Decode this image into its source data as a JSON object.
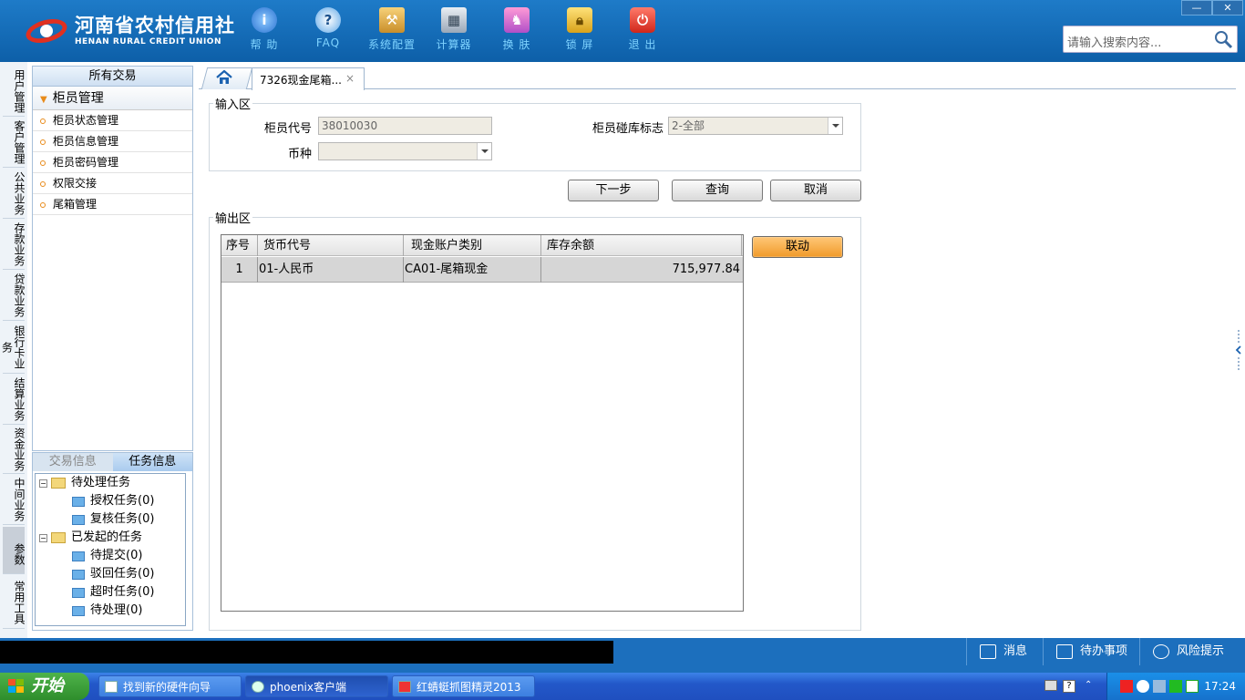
{
  "brand": {
    "name_cn": "河南省农村信用社",
    "name_en": "HENAN RURAL CREDIT UNION"
  },
  "toolbar": [
    {
      "label": "帮 助",
      "icon": "info-icon"
    },
    {
      "label": "FAQ",
      "icon": "question-icon"
    },
    {
      "label": "系统配置",
      "icon": "toolbox-icon"
    },
    {
      "label": "计算器",
      "icon": "calculator-icon"
    },
    {
      "label": "换 肤",
      "icon": "shirt-icon"
    },
    {
      "label": "锁 屏",
      "icon": "lock-icon"
    },
    {
      "label": "退 出",
      "icon": "power-icon"
    }
  ],
  "search": {
    "placeholder": "请输入搜索内容..."
  },
  "vtabs": [
    "用户管理",
    "客户管理",
    "公共业务",
    "存款业务",
    "贷款业务",
    "银行卡业务",
    "结算业务",
    "资金业务",
    "中间业务",
    "参数",
    "常用工具"
  ],
  "menu": {
    "header": "所有交易",
    "group": "柜员管理",
    "items": [
      "柜员状态管理",
      "柜员信息管理",
      "柜员密码管理",
      "权限交接",
      "尾箱管理"
    ]
  },
  "tasks": {
    "tab_trade": "交易信息",
    "tab_task": "任务信息",
    "tree": [
      "待处理任务",
      "授权任务(0)",
      "复核任务(0)",
      "已发起的任务",
      "待提交(0)",
      "驳回任务(0)",
      "超时任务(0)",
      "待处理(0)"
    ]
  },
  "tabs": {
    "current": "7326现金尾箱...",
    "close": "×"
  },
  "input_area": {
    "legend": "输入区",
    "teller_code_label": "柜员代号",
    "teller_code_value": "38010030",
    "vault_flag_label": "柜员碰库标志",
    "vault_flag_value": "2-全部",
    "currency_label": "币种",
    "currency_value": ""
  },
  "buttons": {
    "next": "下一步",
    "query": "查询",
    "cancel": "取消",
    "link": "联动"
  },
  "output_area": {
    "legend": "输出区",
    "columns": [
      "序号",
      "货币代号",
      "现金账户类别",
      "库存余额"
    ],
    "rows": [
      {
        "no": "1",
        "currency": "01-人民币",
        "account_type": "CA01-尾箱现金",
        "balance": "715,977.84"
      }
    ]
  },
  "statusbar": {
    "message": "消息",
    "todo": "待办事项",
    "risk": "风险提示"
  },
  "taskbar": {
    "start": "开始",
    "tasks": [
      "找到新的硬件向导",
      "phoenix客户端",
      "红蜻蜓抓图精灵2013"
    ],
    "clock": "17:24"
  },
  "colors": {
    "header": "#1e7bc8",
    "accent": "#f09a2a",
    "statusbar": "#1c6fbd"
  }
}
